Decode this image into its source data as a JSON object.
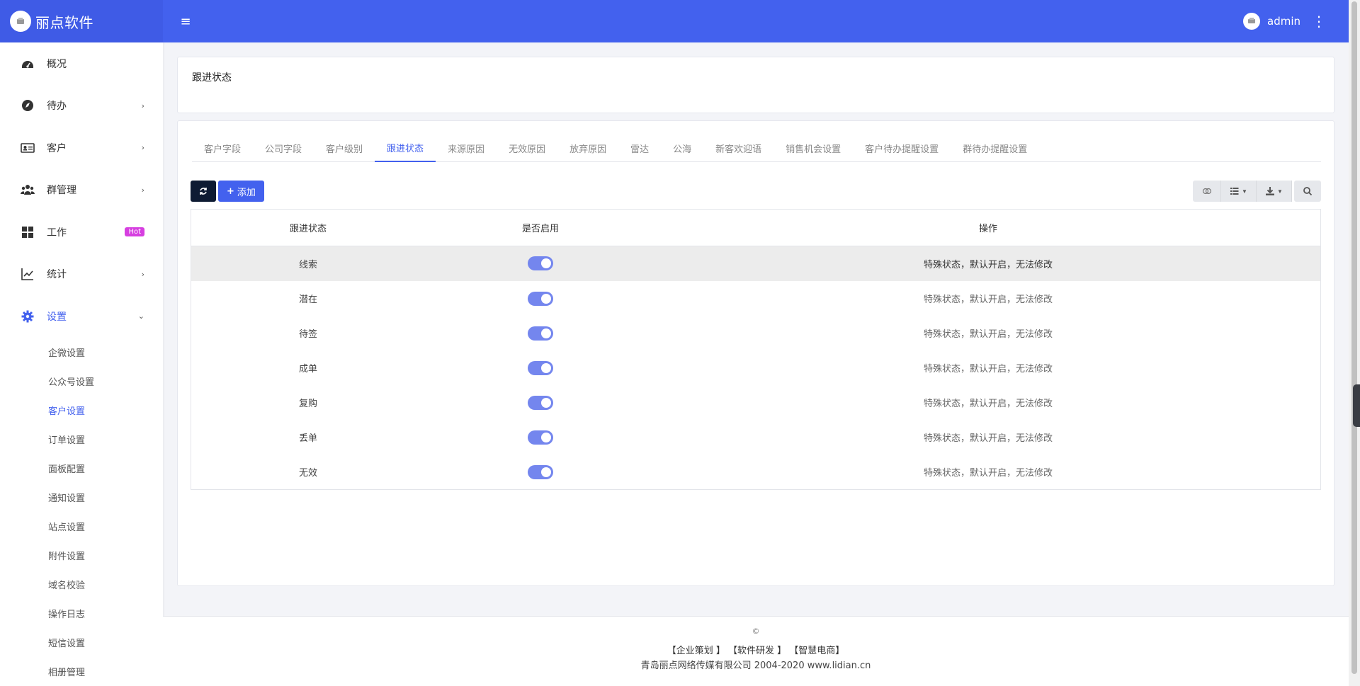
{
  "header": {
    "brand": "丽点软件",
    "user": "admin"
  },
  "sidebar": {
    "items": [
      {
        "label": "概况",
        "icon": "dashboard-icon"
      },
      {
        "label": "待办",
        "icon": "compass-icon"
      },
      {
        "label": "客户",
        "icon": "id-card-icon"
      },
      {
        "label": "群管理",
        "icon": "users-icon"
      },
      {
        "label": "工作",
        "icon": "grid-icon",
        "badge": "Hot"
      },
      {
        "label": "统计",
        "icon": "chart-line-icon"
      },
      {
        "label": "设置",
        "icon": "gear-icon"
      }
    ],
    "settings_sub": [
      "企微设置",
      "公众号设置",
      "客户设置",
      "订单设置",
      "面板配置",
      "通知设置",
      "站点设置",
      "附件设置",
      "域名校验",
      "操作日志",
      "短信设置",
      "相册管理"
    ]
  },
  "page": {
    "title": "跟进状态"
  },
  "tabs": [
    "客户字段",
    "公司字段",
    "客户级别",
    "跟进状态",
    "来源原因",
    "无效原因",
    "放弃原因",
    "雷达",
    "公海",
    "新客欢迎语",
    "销售机会设置",
    "客户待办提醒设置",
    "群待办提醒设置"
  ],
  "toolbar": {
    "add_label": "添加"
  },
  "table": {
    "columns": [
      "跟进状态",
      "是否启用",
      "操作"
    ],
    "rows": [
      {
        "status": "线索",
        "enabled": true,
        "op": "特殊状态，默认开启，无法修改"
      },
      {
        "status": "潜在",
        "enabled": true,
        "op": "特殊状态，默认开启，无法修改"
      },
      {
        "status": "待签",
        "enabled": true,
        "op": "特殊状态，默认开启，无法修改"
      },
      {
        "status": "成单",
        "enabled": true,
        "op": "特殊状态，默认开启，无法修改"
      },
      {
        "status": "复购",
        "enabled": true,
        "op": "特殊状态，默认开启，无法修改"
      },
      {
        "status": "丢单",
        "enabled": true,
        "op": "特殊状态，默认开启，无法修改"
      },
      {
        "status": "无效",
        "enabled": true,
        "op": "特殊状态，默认开启，无法修改"
      }
    ]
  },
  "footer": {
    "copyright": "©",
    "links": [
      "【企业策划 】",
      "【软件研发 】",
      "【智慧电商】"
    ],
    "company": "青岛丽点网络传媒有限公司 2004-2020 www.lidian.cn"
  },
  "colors": {
    "primary": "#4361ee",
    "hot": "#d63fe0",
    "toggle_on": "#7486ee"
  }
}
